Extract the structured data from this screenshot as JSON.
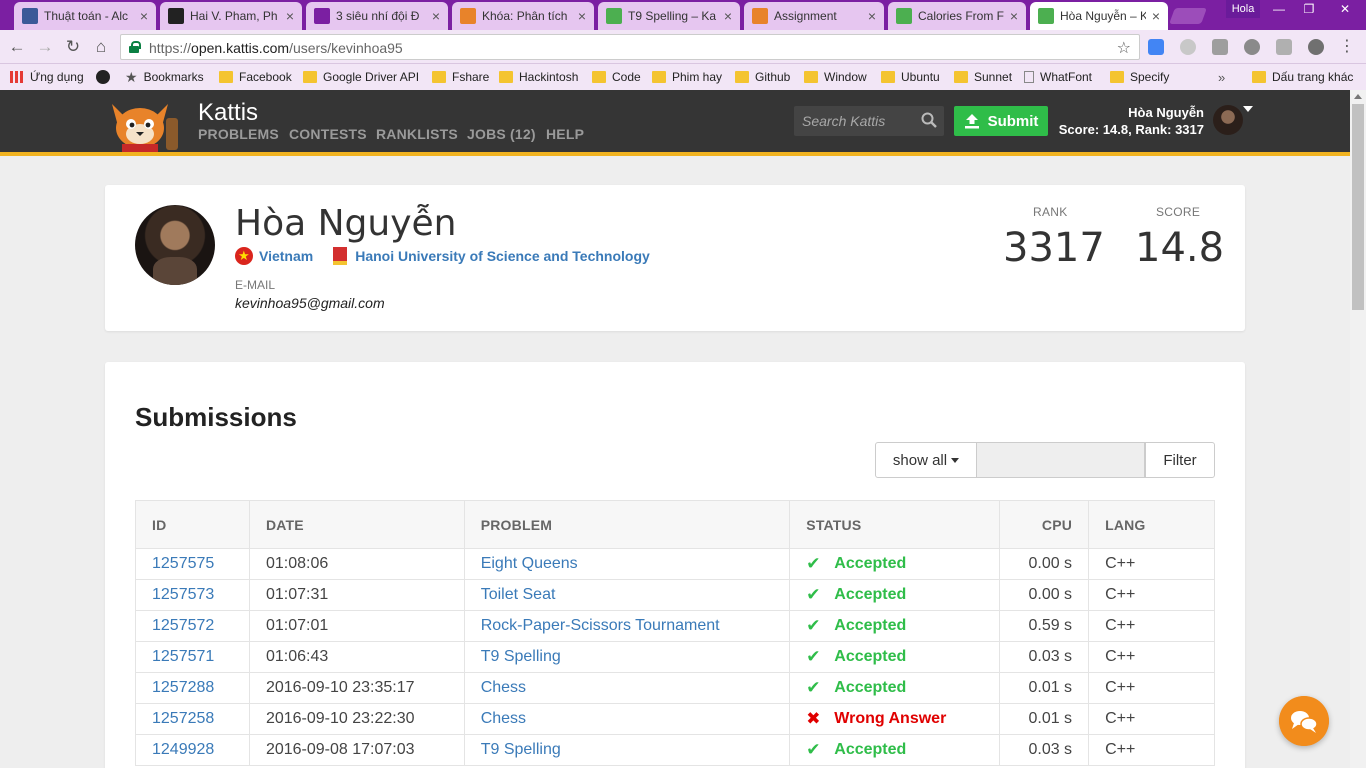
{
  "browser": {
    "tabs": [
      {
        "label": "Thuật toán - Alc",
        "favicon": "facebook-icon",
        "color": "#3b5998",
        "active": false
      },
      {
        "label": "Hai V. Pham, Ph",
        "favicon": "academia-icon",
        "color": "#222222",
        "active": false
      },
      {
        "label": "3 siêu nhí đội Đ",
        "favicon": "yahoo-icon",
        "color": "#7b1fa2",
        "active": false
      },
      {
        "label": "Khóa: Phân tích",
        "favicon": "moodle-icon",
        "color": "#e8832a",
        "active": false
      },
      {
        "label": "T9 Spelling – Ka",
        "favicon": "kattis-icon",
        "color": "#4caf50",
        "active": false
      },
      {
        "label": "Assignment",
        "favicon": "moodle-icon",
        "color": "#e8832a",
        "active": false
      },
      {
        "label": "Calories From F",
        "favicon": "kattis-icon",
        "color": "#4caf50",
        "active": false
      },
      {
        "label": "Hòa Nguyễn – K",
        "favicon": "kattis-icon",
        "color": "#4caf50",
        "active": true
      }
    ],
    "profile_label": "Hola",
    "url_scheme": "https://",
    "url_host": "open.kattis.com",
    "url_path": "/users/kevinhoa95",
    "bookmarks": [
      {
        "label": "Ứng dụng",
        "icon": "apps-grid-icon"
      },
      {
        "label": "",
        "icon": "github-icon"
      },
      {
        "label": "Bookmarks",
        "icon": "star-icon"
      },
      {
        "label": "Facebook",
        "icon": "folder-icon"
      },
      {
        "label": "Google Driver API",
        "icon": "folder-icon"
      },
      {
        "label": "Fshare",
        "icon": "folder-icon"
      },
      {
        "label": "Hackintosh",
        "icon": "folder-icon"
      },
      {
        "label": "Code",
        "icon": "folder-icon"
      },
      {
        "label": "Phim hay",
        "icon": "folder-icon"
      },
      {
        "label": "Github",
        "icon": "folder-icon"
      },
      {
        "label": "Window",
        "icon": "folder-icon"
      },
      {
        "label": "Ubuntu",
        "icon": "folder-icon"
      },
      {
        "label": "Sunnet",
        "icon": "folder-icon"
      },
      {
        "label": "WhatFont",
        "icon": "page-icon"
      },
      {
        "label": "Specify",
        "icon": "folder-icon"
      }
    ],
    "bookmarks_overflow": "»",
    "other_bookmarks": "Dấu trang khác"
  },
  "site": {
    "brand": "Kattis",
    "nav": [
      "PROBLEMS",
      "CONTESTS",
      "RANKLISTS",
      "JOBS (12)",
      "HELP"
    ],
    "search_placeholder": "Search Kattis",
    "submit_label": "Submit",
    "user_name": "Hòa Nguyễn",
    "user_summary": "Score: 14.8, Rank: 3317",
    "accent": "#f1b320",
    "header_bg": "#353535",
    "submit_color": "#2fbd49"
  },
  "profile": {
    "name": "Hòa Nguyễn",
    "country": "Vietnam",
    "university": "Hanoi University of Science and Technology",
    "email_label": "E-MAIL",
    "email": "kevinhoa95@gmail.com",
    "rank_label": "RANK",
    "rank": "3317",
    "score_label": "SCORE",
    "score": "14.8"
  },
  "submissions": {
    "title": "Submissions",
    "show_all_label": "show all",
    "filter_value": "",
    "filter_label": "Filter",
    "columns": [
      "ID",
      "DATE",
      "PROBLEM",
      "STATUS",
      "CPU",
      "LANG"
    ],
    "rows": [
      {
        "id": "1257575",
        "date": "01:08:06",
        "problem": "Eight Queens",
        "status": "Accepted",
        "ok": true,
        "cpu": "0.00 s",
        "lang": "C++"
      },
      {
        "id": "1257573",
        "date": "01:07:31",
        "problem": "Toilet Seat",
        "status": "Accepted",
        "ok": true,
        "cpu": "0.00 s",
        "lang": "C++"
      },
      {
        "id": "1257572",
        "date": "01:07:01",
        "problem": "Rock-Paper-Scissors Tournament",
        "status": "Accepted",
        "ok": true,
        "cpu": "0.59 s",
        "lang": "C++"
      },
      {
        "id": "1257571",
        "date": "01:06:43",
        "problem": "T9 Spelling",
        "status": "Accepted",
        "ok": true,
        "cpu": "0.03 s",
        "lang": "C++"
      },
      {
        "id": "1257288",
        "date": "2016-09-10 23:35:17",
        "problem": "Chess",
        "status": "Accepted",
        "ok": true,
        "cpu": "0.01 s",
        "lang": "C++"
      },
      {
        "id": "1257258",
        "date": "2016-09-10 23:22:30",
        "problem": "Chess",
        "status": "Wrong Answer",
        "ok": false,
        "cpu": "0.01 s",
        "lang": "C++"
      },
      {
        "id": "1249928",
        "date": "2016-09-08 17:07:03",
        "problem": "T9 Spelling",
        "status": "Accepted",
        "ok": true,
        "cpu": "0.03 s",
        "lang": "C++"
      }
    ],
    "accepted_color": "#2fbd49",
    "wrong_color": "#e00000"
  }
}
